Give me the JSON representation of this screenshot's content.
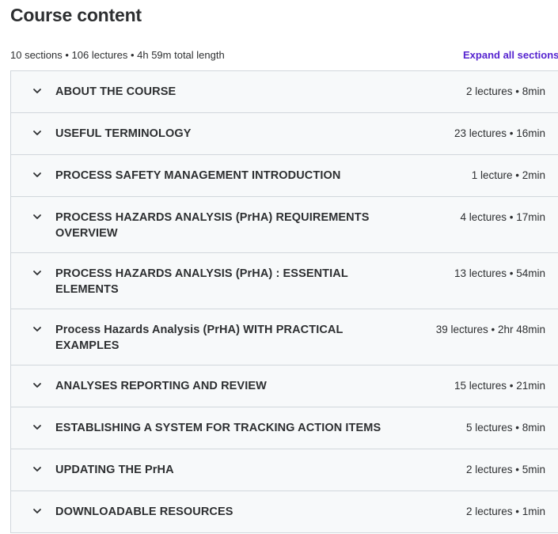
{
  "header": {
    "title": "Course content",
    "summary": "10 sections • 106 lectures • 4h 59m total length",
    "expand_label": "Expand all sections"
  },
  "icons": {
    "section_toggle": "chevron-down-icon"
  },
  "colors": {
    "accent": "#5624d0",
    "section_bg": "#f7f9fa",
    "border": "#d1d7dc",
    "text": "#2d2f31"
  },
  "sections": [
    {
      "title": "ABOUT THE COURSE",
      "meta": "2 lectures • 8min"
    },
    {
      "title": "USEFUL TERMINOLOGY",
      "meta": "23 lectures • 16min"
    },
    {
      "title": "PROCESS SAFETY MANAGEMENT INTRODUCTION",
      "meta": "1 lecture • 2min"
    },
    {
      "title": "PROCESS HAZARDS ANALYSIS (PrHA) REQUIREMENTS OVERVIEW",
      "meta": "4 lectures • 17min"
    },
    {
      "title": "PROCESS HAZARDS ANALYSIS (PrHA) : ESSENTIAL ELEMENTS",
      "meta": "13 lectures • 54min"
    },
    {
      "title": "Process Hazards Analysis (PrHA) WITH PRACTICAL EXAMPLES",
      "meta": "39 lectures • 2hr 48min"
    },
    {
      "title": "ANALYSES REPORTING AND REVIEW",
      "meta": "15 lectures • 21min"
    },
    {
      "title": "ESTABLISHING A SYSTEM FOR TRACKING ACTION ITEMS",
      "meta": "5 lectures • 8min"
    },
    {
      "title": "UPDATING THE PrHA",
      "meta": "2 lectures • 5min"
    },
    {
      "title": "DOWNLOADABLE RESOURCES",
      "meta": "2 lectures • 1min"
    }
  ]
}
